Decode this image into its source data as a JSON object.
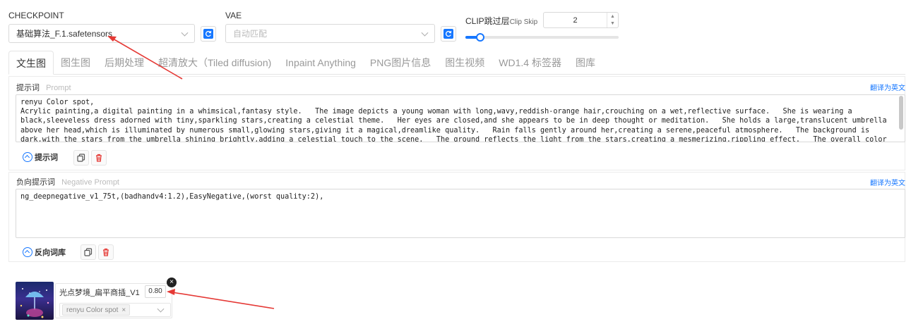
{
  "checkpoint": {
    "label": "CHECKPOINT",
    "value": "基础算法_F.1.safetensors"
  },
  "vae": {
    "label": "VAE",
    "placeholder": "自动匹配"
  },
  "clip": {
    "label": "CLIP跳过层",
    "sub_label": "Clip Skip",
    "value": "2",
    "slider_fraction": 0.1
  },
  "tabs": [
    {
      "label": "文生图",
      "active": true
    },
    {
      "label": "图生图",
      "active": false
    },
    {
      "label": "后期处理",
      "active": false
    },
    {
      "label": "超清放大（Tiled diffusion)",
      "active": false
    },
    {
      "label": "Inpaint Anything",
      "active": false
    },
    {
      "label": "PNG图片信息",
      "active": false
    },
    {
      "label": "图生视频",
      "active": false
    },
    {
      "label": "WD1.4 标签器",
      "active": false
    },
    {
      "label": "图库",
      "active": false
    }
  ],
  "prompt": {
    "label": "提示词",
    "label_en": "Prompt",
    "translate": "翻译为英文",
    "text": "renyu Color spot,\nAcrylic painting,a digital painting in a whimsical,fantasy style.   The image depicts a young woman with long,wavy,reddish-orange hair,crouching on a wet,reflective surface.   She is wearing a black,sleeveless dress adorned with tiny,sparkling stars,creating a celestial theme.   Her eyes are closed,and she appears to be in deep thought or meditation.   She holds a large,translucent umbrella above her head,which is illuminated by numerous small,glowing stars,giving it a magical,dreamlike quality.   Rain falls gently around her,creating a serene,peaceful atmosphere.   The background is dark,with the stars from the umbrella shining brightly,adding a celestial touch to the scene.   The ground reflects the light from the stars,creating a mesmerizing,rippling effect.   The overall color palette is dominated by warm hues,with the rain adding a",
    "button": "提示词"
  },
  "negative": {
    "label": "负向提示词",
    "label_en": "Negative Prompt",
    "translate": "翻译为英文",
    "text": "ng_deepnegative_v1_75t,(badhandv4:1.2),EasyNegative,(worst quality:2),",
    "button": "反向词库"
  },
  "lora": {
    "name": "光点梦境_扁平商插_V1",
    "weight": "0.80",
    "tag": "renyu Color spot",
    "tag_remove": "×"
  },
  "colors": {
    "accent": "#1677ff",
    "delete": "#e53935",
    "arrow": "#e53935"
  }
}
